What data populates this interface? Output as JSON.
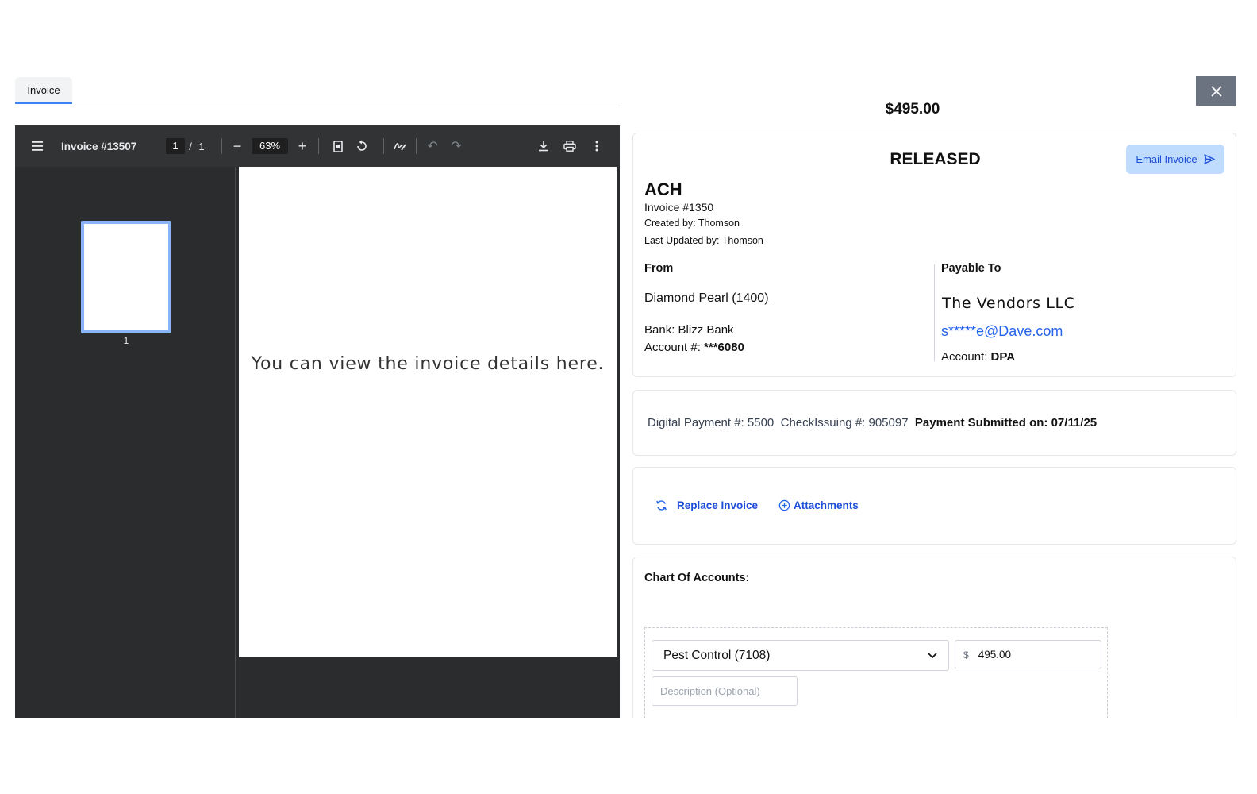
{
  "left_tab": {
    "label": "Invoice"
  },
  "pdf": {
    "title": "Invoice #13507",
    "page_current": "1",
    "page_sep": "/",
    "page_total": "1",
    "zoom": "63%",
    "thumb_label": "1",
    "body_text": "You can view the invoice details here."
  },
  "header": {
    "amount": "$495.00"
  },
  "invoice": {
    "status": "RELEASED",
    "email_button": "Email Invoice",
    "method": "ACH",
    "number": "Invoice #1350",
    "created_by": "Created by: Thomson",
    "updated_by": "Last Updated by: Thomson",
    "from_label": "From",
    "from_name": "Diamond Pearl (1400)",
    "bank": "Bank: Blizz Bank",
    "account_label": "Account #: ",
    "account_value": "***6080",
    "payable_label": "Payable To",
    "vendor_name": "The Vendors LLC",
    "vendor_email": "s*****e@Dave.com",
    "vendor_account_label": "Account: ",
    "vendor_account_value": "DPA"
  },
  "payment": {
    "digital": "Digital Payment #: 5500",
    "check": "CheckIssuing #: 905097",
    "submitted": "Payment Submitted on: 07/11/25"
  },
  "actions": {
    "replace": "Replace Invoice",
    "attachments": "Attachments"
  },
  "coa": {
    "title": "Chart Of Accounts:",
    "account_selected": "Pest Control (7108)",
    "currency": "$",
    "amount": "495.00",
    "description_placeholder": "Description (Optional)"
  },
  "colors": {
    "accent": "#2563eb",
    "email_button_bg": "#bfdbfe",
    "close_bg": "#6b7280",
    "viewer_bg": "#2b2c2e"
  }
}
